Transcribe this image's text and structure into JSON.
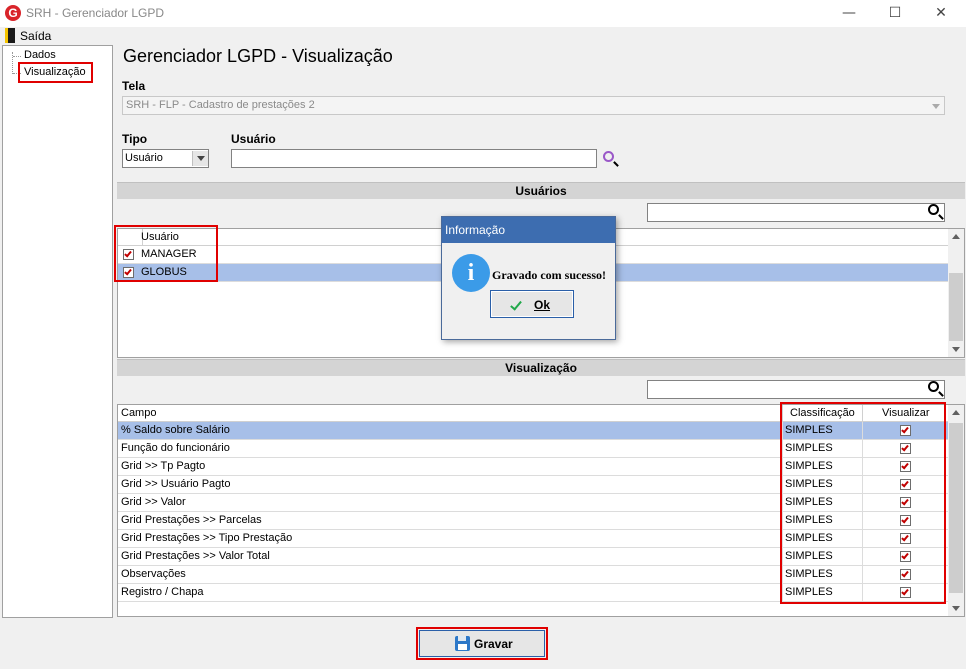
{
  "window": {
    "title": "SRH - Gerenciador LGPD",
    "logo_letter": "G",
    "minimize": "—",
    "maximize": "☐",
    "close": "✕"
  },
  "menu": {
    "exit_label": "Saída"
  },
  "tree": {
    "items": [
      "Dados",
      "Visualização"
    ]
  },
  "page_title": "Gerenciador LGPD - Visualização",
  "tela": {
    "label": "Tela",
    "value": "SRH - FLP - Cadastro de prestações 2"
  },
  "tipo": {
    "label": "Tipo",
    "value": "Usuário"
  },
  "usuario_field": {
    "label": "Usuário",
    "value": ""
  },
  "users_section": {
    "title": "Usuários",
    "column": "Usuário",
    "rows": [
      {
        "name": "MANAGER",
        "checked": true,
        "selected": false
      },
      {
        "name": "GLOBUS",
        "checked": true,
        "selected": true
      }
    ]
  },
  "visualization_section": {
    "title": "Visualização",
    "columns": [
      "Campo",
      "Classificação",
      "Visualizar"
    ],
    "rows": [
      {
        "campo": "% Saldo sobre Salário",
        "classificacao": "SIMPLES",
        "visualizar": true,
        "selected": true
      },
      {
        "campo": "Função do funcionário",
        "classificacao": "SIMPLES",
        "visualizar": true,
        "selected": false
      },
      {
        "campo": "Grid >> Tp Pagto",
        "classificacao": "SIMPLES",
        "visualizar": true,
        "selected": false
      },
      {
        "campo": "Grid >> Usuário Pagto",
        "classificacao": "SIMPLES",
        "visualizar": true,
        "selected": false
      },
      {
        "campo": "Grid >> Valor",
        "classificacao": "SIMPLES",
        "visualizar": true,
        "selected": false
      },
      {
        "campo": "Grid Prestações >> Parcelas",
        "classificacao": "SIMPLES",
        "visualizar": true,
        "selected": false
      },
      {
        "campo": "Grid Prestações >> Tipo Prestação",
        "classificacao": "SIMPLES",
        "visualizar": true,
        "selected": false
      },
      {
        "campo": "Grid Prestações >> Valor Total",
        "classificacao": "SIMPLES",
        "visualizar": true,
        "selected": false
      },
      {
        "campo": "Observações",
        "classificacao": "SIMPLES",
        "visualizar": true,
        "selected": false
      },
      {
        "campo": "Registro / Chapa",
        "classificacao": "SIMPLES",
        "visualizar": true,
        "selected": false
      }
    ]
  },
  "dialog": {
    "title": "Informação",
    "icon": "i",
    "message": "Gravado com sucesso!",
    "ok_label": "Ok"
  },
  "save_button": {
    "label": "Gravar"
  },
  "colors": {
    "selection": "#a7bfe8",
    "highlight_box": "#e00000",
    "dialog_title": "#3d6db0",
    "check": "#c00000"
  }
}
